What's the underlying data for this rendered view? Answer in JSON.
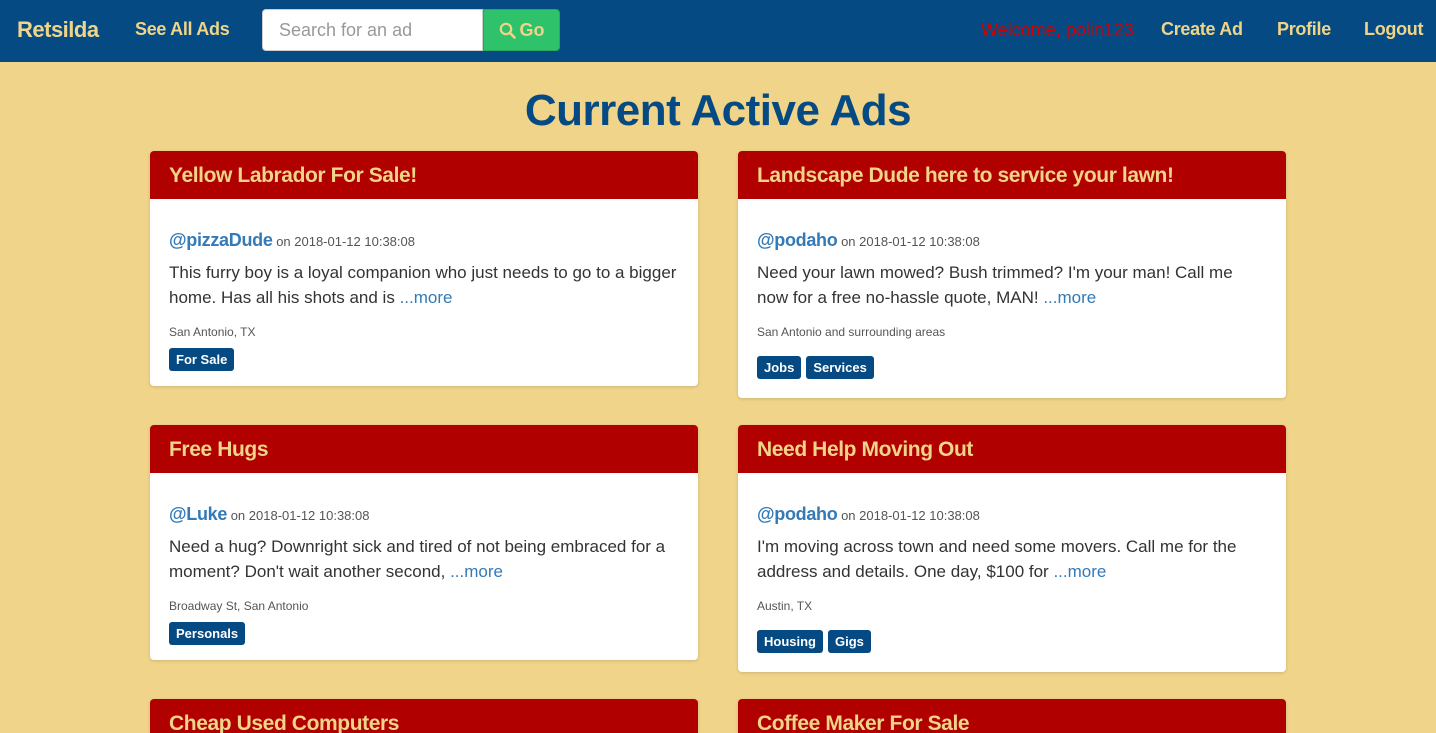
{
  "nav": {
    "brand": "Retsilda",
    "see_all": "See All Ads",
    "search_placeholder": "Search for an ad",
    "go_label": "Go",
    "welcome": "Welcome, polin123",
    "create_ad": "Create Ad",
    "profile": "Profile",
    "logout": "Logout"
  },
  "page": {
    "title": "Current Active Ads"
  },
  "ads": [
    {
      "title": "Yellow Labrador For Sale!",
      "user": "@pizzaDude",
      "date": "on 2018-01-12 10:38:08",
      "description": "This furry boy is a loyal companion who just needs to go to a bigger home. Has all his shots and is",
      "more": "...more",
      "location": "San Antonio, TX",
      "tags": [
        "For Sale"
      ]
    },
    {
      "title": "Landscape Dude here to service your lawn!",
      "user": "@podaho",
      "date": "on 2018-01-12 10:38:08",
      "description": "Need your lawn mowed? Bush trimmed? I'm your man! Call me now for a free no-hassle quote, MAN!",
      "more": "...more",
      "location": "San Antonio and surrounding areas",
      "tags": [
        "Jobs",
        "Services"
      ]
    },
    {
      "title": "Free Hugs",
      "user": "@Luke",
      "date": "on 2018-01-12 10:38:08",
      "description": "Need a hug? Downright sick and tired of not being embraced for a moment? Don't wait another second,",
      "more": "...more",
      "location": "Broadway St, San Antonio",
      "tags": [
        "Personals"
      ]
    },
    {
      "title": "Need Help Moving Out",
      "user": "@podaho",
      "date": "on 2018-01-12 10:38:08",
      "description": "I'm moving across town and need some movers. Call me for the address and details. One day, $100 for",
      "more": "...more",
      "location": "Austin, TX",
      "tags": [
        "Housing",
        "Gigs"
      ]
    },
    {
      "title": "Cheap Used Computers"
    },
    {
      "title": "Coffee Maker For Sale"
    }
  ]
}
